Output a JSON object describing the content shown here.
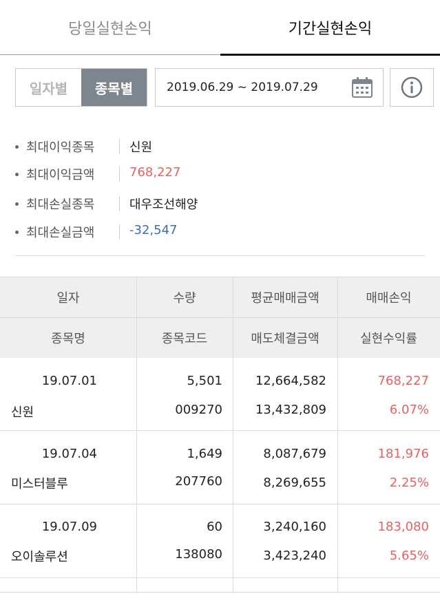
{
  "tabs": {
    "daily": "당일실현손익",
    "period": "기간실현손익"
  },
  "filter": {
    "by_date": "일자별",
    "by_stock": "종목별",
    "date_range": "2019.06.29 ~ 2019.07.29"
  },
  "summary": [
    {
      "label": "최대이익종목",
      "value": "신원"
    },
    {
      "label": "최대이익금액",
      "value": "768,227"
    },
    {
      "label": "최대손실종목",
      "value": "대우조선해양"
    },
    {
      "label": "최대손실금액",
      "value": "-32,547"
    }
  ],
  "table": {
    "headers_row1": [
      "일자",
      "수량",
      "평균매매금액",
      "매매손익"
    ],
    "headers_row2": [
      "종목명",
      "종목코드",
      "매도체결금액",
      "실현수익률"
    ],
    "rows": [
      {
        "date": "19.07.01",
        "qty": "5,501",
        "avg_amount": "12,664,582",
        "pnl": "768,227",
        "name": "신원",
        "code": "009270",
        "sell_amount": "13,432,809",
        "rate": "6.07%"
      },
      {
        "date": "19.07.04",
        "qty": "1,649",
        "avg_amount": "8,087,679",
        "pnl": "181,976",
        "name": "미스터블루",
        "code": "207760",
        "sell_amount": "8,269,655",
        "rate": "2.25%"
      },
      {
        "date": "19.07.09",
        "qty": "60",
        "avg_amount": "3,240,160",
        "pnl": "183,080",
        "name": "오이솔루션",
        "code": "138080",
        "sell_amount": "3,423,240",
        "rate": "5.65%"
      }
    ]
  },
  "colors": {
    "profit": "#e8615f",
    "loss": "#3a6fb5",
    "active_segment": "#7d858e"
  },
  "icons": {
    "calendar": "calendar-icon",
    "info": "info-icon"
  }
}
